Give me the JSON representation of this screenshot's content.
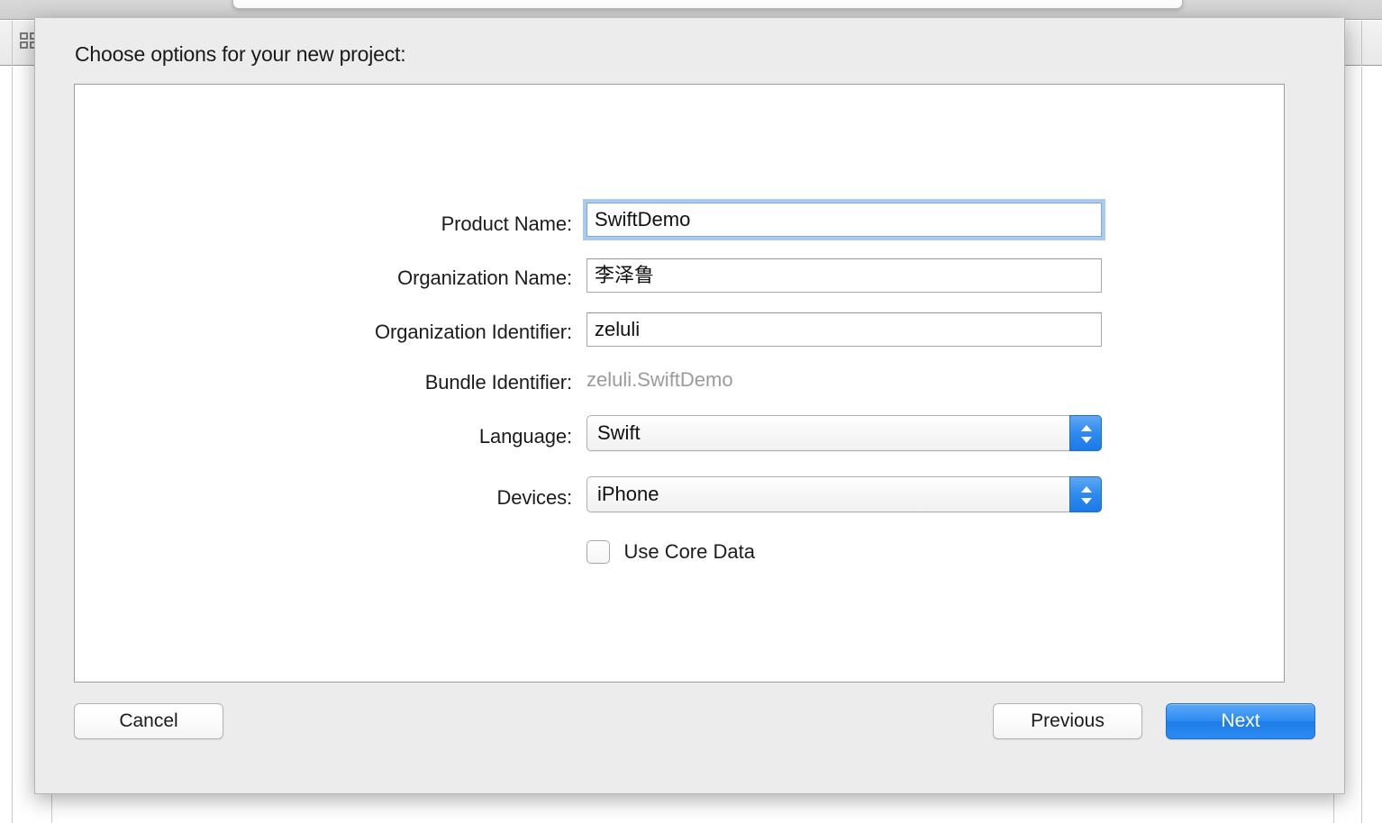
{
  "background_window": {
    "view_mode_icon": "editor-layout-icon"
  },
  "sheet": {
    "title": "Choose options for your new project:",
    "fields": [
      {
        "key": "product_name",
        "label": "Product Name:",
        "type": "text",
        "value": "SwiftDemo",
        "placeholder": "",
        "focused": true
      },
      {
        "key": "organization_name",
        "label": "Organization Name:",
        "type": "text",
        "value": "李泽鲁",
        "placeholder": "",
        "focused": false
      },
      {
        "key": "organization_identifier",
        "label": "Organization Identifier:",
        "type": "text",
        "value": "zeluli",
        "placeholder": "",
        "focused": false
      },
      {
        "key": "bundle_identifier",
        "label": "Bundle Identifier:",
        "type": "readonly",
        "value": "zeluli.SwiftDemo"
      },
      {
        "key": "language",
        "label": "Language:",
        "type": "popup",
        "value": "Swift"
      },
      {
        "key": "devices",
        "label": "Devices:",
        "type": "popup",
        "value": "iPhone"
      }
    ],
    "checkbox": {
      "label": "Use Core Data",
      "checked": false
    },
    "buttons": {
      "cancel": "Cancel",
      "previous": "Previous",
      "next": "Next"
    }
  },
  "colors": {
    "accent_blue": "#2e8cf0",
    "focus_ring": "#a9cbef",
    "sheet_bg": "#ececec",
    "panel_bg": "#ffffff",
    "readonly_text": "#9b9b9b",
    "label_text": "#1c1c1c"
  }
}
